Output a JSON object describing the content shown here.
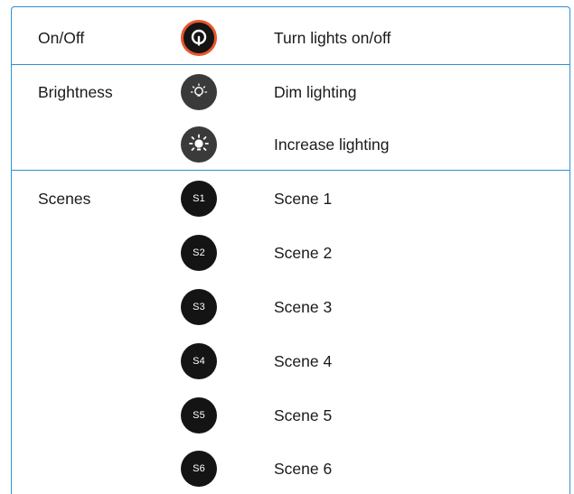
{
  "rows": {
    "onoff": {
      "label": "On/Off",
      "icon": "power-bulb-icon",
      "description": "Turn lights on/off",
      "accent": "#e8562a"
    },
    "brightness": {
      "label": "Brightness",
      "dim": {
        "icon": "dim-bulb-icon",
        "description": "Dim lighting"
      },
      "increase": {
        "icon": "bright-sun-icon",
        "description": "Increase lighting"
      }
    },
    "scenes": {
      "label": "Scenes",
      "items": [
        {
          "button": "S1",
          "description": "Scene 1"
        },
        {
          "button": "S2",
          "description": "Scene 2"
        },
        {
          "button": "S3",
          "description": "Scene 3"
        },
        {
          "button": "S4",
          "description": "Scene 4"
        },
        {
          "button": "S5",
          "description": "Scene 5"
        },
        {
          "button": "S6",
          "description": "Scene 6"
        }
      ]
    }
  },
  "colors": {
    "border": "#2f8fd6",
    "button_dark": "#141414",
    "button_grey": "#3a3a3a"
  }
}
